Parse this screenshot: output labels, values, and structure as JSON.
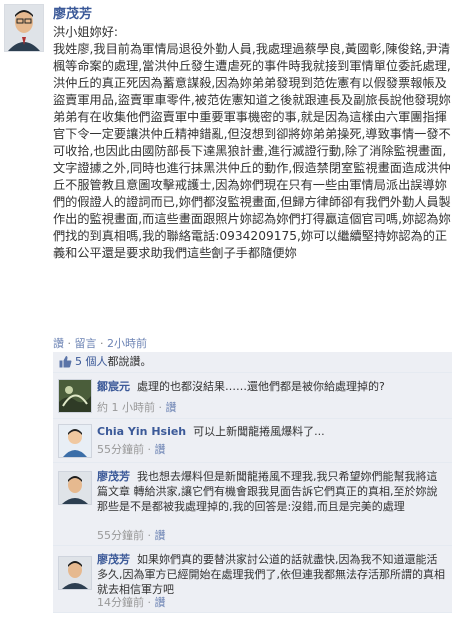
{
  "post": {
    "author": "廖茂芳",
    "greeting": "洪小姐妳好:",
    "body": "我姓廖,我目前為軍情局退役外勤人員,我處理過蔡學良,黃國彰,陳俊銘,尹清楓等命案的處理,當洪仲丘發生遭虐死的事件時我就接到軍情單位委託處理,洪仲丘的真正死因為蓄意謀殺,因為妳弟弟發現到范佐憲有以假發票報帳及盜賣軍用品,盜賣軍車零件,被范佐憲知道之後就跟連長及副旅長說他發現妳弟弟有在收集他們盜賣軍中重要軍事機密的事,就是因為這樣由六軍團指揮官下令一定要讓洪仲丘精神錯亂,但沒想到卻將妳弟弟操死,導致事情一發不可收拾,也因此由國防部長下達黑狼計畫,進行滅證行動,除了消除監視畫面,文字證據之外,同時也進行抹黑洪仲丘的動作,假造禁閉室監視畫面造成洪仲丘不服管教且意圖攻擊戒護士,因為妳們現在只有一些由軍情局派出誤導妳們的假證人的證詞而已,妳們都沒監視畫面,但歸方律師卻有我們外勤人員製作出的監視畫面,而這些畫面跟照片妳認為妳們打得贏這個官司嗎,妳認為妳們找的到真相嗎,我的聯絡電話:0934209175,妳可以繼續堅持妳認為的正義和公平還是要求助我們這些劊子手都隨便妳",
    "actions": {
      "like": "讚",
      "comment": "留言",
      "sep": " · ",
      "time": "2小時前"
    },
    "likes": {
      "count_label": "5 個人",
      "suffix": "都說讚。"
    }
  },
  "comments": [
    {
      "author": "鄒宸元",
      "text": "處理的也都沒結果……還他們都是被你給處理掉的?",
      "time": "約 1 小時前",
      "like": "讚"
    },
    {
      "author": "Chia Yin Hsieh",
      "text": "可以上新聞龍捲風爆料了...",
      "time": "55分鐘前",
      "like": "讚"
    },
    {
      "author": "廖茂芳",
      "text": "我也想去爆料但是新聞龍捲風不理我,我只希望妳們能幫我將這篇文章 轉給洪家,讓它們有機會跟我見面告訴它們真正的真相,至於妳說那些是不是都被我處理掉的,我的回答是:沒錯,而且是完美的處理",
      "time": "55分鐘前",
      "like": "讚"
    },
    {
      "author": "廖茂芳",
      "text": "如果妳們真的要替洪家討公道的話就盡快,因為我不知道還能活多久,因為軍方已經開始在處理我們了,依但連我都無法存活那所謂的真相就去相信軍方吧",
      "time": "14分鐘前",
      "like": "讚"
    }
  ],
  "colors": {
    "link": "#3b5998",
    "meta_link": "#6d84b4",
    "comment_bg": "#edeff4"
  }
}
